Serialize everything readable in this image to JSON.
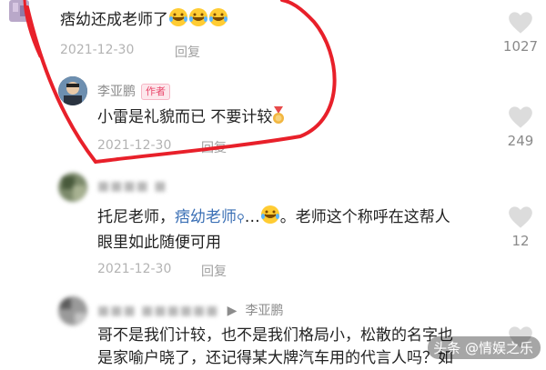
{
  "comment1": {
    "text": "痞幼还成老师了",
    "date": "2021-12-30",
    "reply_label": "回复",
    "likes": "1027"
  },
  "reply1": {
    "username": "李亚鹏",
    "badge": "作者",
    "text": "小雷是礼貌而已 不要计较",
    "date": "2021-12-30",
    "reply_label": "回复",
    "likes": "249"
  },
  "comment2": {
    "username_blurred": "■■■■ ■",
    "text_pre": "托尼老师，",
    "mention": "痞幼老师",
    "text_mid": "…",
    "text_post": "。老师这个称呼在这帮人",
    "text_line2": "眼里如此随便可用",
    "date": "2021-12-30",
    "reply_label": "回复",
    "likes": "12"
  },
  "comment3": {
    "username_blurred": "■■■ ■■■■■■",
    "reply_to": "李亚鹏",
    "text_line1": "哥不是我们计较，也不是我们格局小，松散的名字也",
    "text_line2": "是家喻户晓了，还记得某大牌汽车用的代言人吗？如"
  },
  "watermark": {
    "text": "头条 @情娱之乐"
  },
  "colors": {
    "annotation_circle": "#e8202a",
    "author_badge": "#e9476b",
    "mention": "#3a6fb5",
    "heart": "#dcdcdc"
  }
}
